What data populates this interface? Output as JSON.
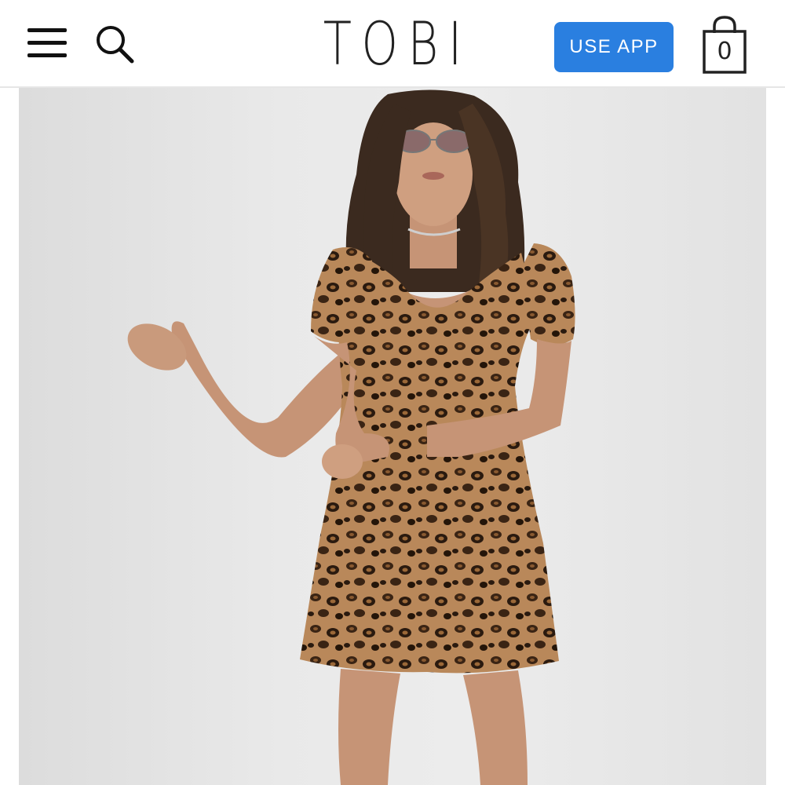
{
  "header": {
    "logo_text": "TOBI",
    "use_app_label": "USE APP",
    "cart_count": "0"
  },
  "icons": {
    "menu": "hamburger-menu-icon",
    "search": "search-icon",
    "cart": "shopping-bag-icon"
  },
  "colors": {
    "accent": "#2a7fe0",
    "background": "#ffffff",
    "image_backdrop": "#e8e8e8"
  }
}
